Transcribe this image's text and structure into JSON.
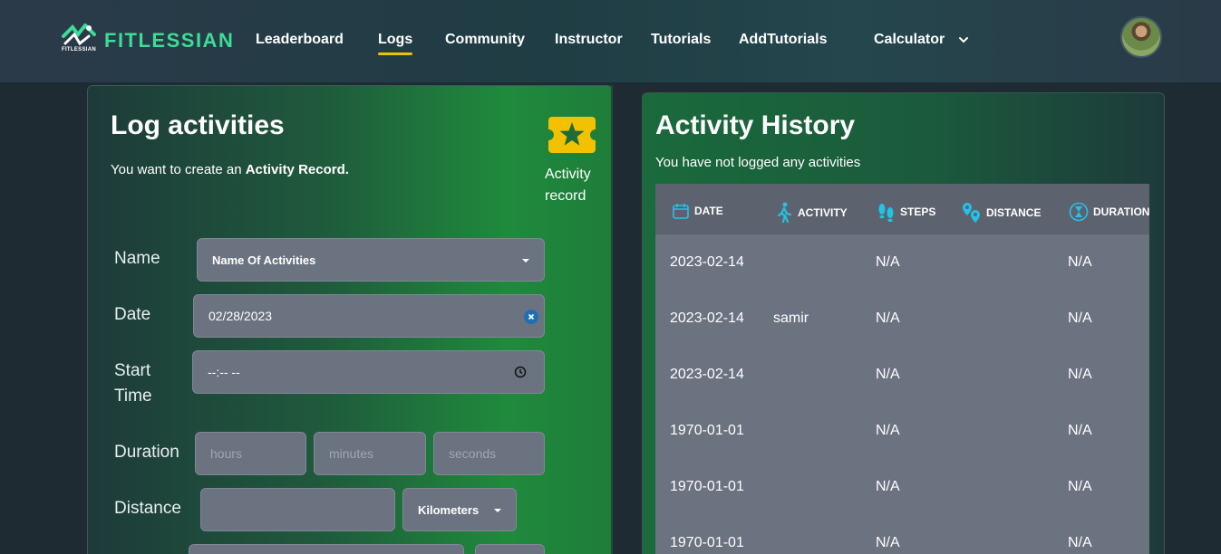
{
  "brand": {
    "name": "FITLESSIAN",
    "sub": "FITLESSIAN"
  },
  "nav": {
    "links": [
      "Leaderboard",
      "Logs",
      "Community",
      "Instructor",
      "Tutorials",
      "AddTutorials"
    ],
    "active": "Logs",
    "calculator": "Calculator"
  },
  "log": {
    "title": "Log activities",
    "subtitle_prefix": "You want to create an ",
    "subtitle_bold": "Activity Record.",
    "badge_label": "Activity record",
    "fields": {
      "name_label": "Name",
      "name_value": "Name Of Activities",
      "date_label": "Date",
      "date_value": "02/28/2023",
      "start_label_1": "Start",
      "start_label_2": "Time",
      "start_value": "--:-- --",
      "duration_label": "Duration",
      "hours_ph": "hours",
      "minutes_ph": "minutes",
      "seconds_ph": "seconds",
      "distance_label": "Distance",
      "distance_value": "",
      "unit": "Kilometers"
    }
  },
  "history": {
    "title": "Activity History",
    "subtitle": "You have not logged any activities",
    "columns": [
      "DATE",
      "ACTIVITY",
      "STEPS",
      "DISTANCE",
      "DURATION"
    ],
    "rows": [
      {
        "date": "2023-02-14",
        "activity": "",
        "steps": "N/A",
        "distance": "",
        "duration": "N/A"
      },
      {
        "date": "2023-02-14",
        "activity": "samir",
        "steps": "N/A",
        "distance": "",
        "duration": "N/A"
      },
      {
        "date": "2023-02-14",
        "activity": "",
        "steps": "N/A",
        "distance": "",
        "duration": "N/A"
      },
      {
        "date": "1970-01-01",
        "activity": "",
        "steps": "N/A",
        "distance": "",
        "duration": "N/A"
      },
      {
        "date": "1970-01-01",
        "activity": "",
        "steps": "N/A",
        "distance": "",
        "duration": "N/A"
      },
      {
        "date": "1970-01-01",
        "activity": "",
        "steps": "N/A",
        "distance": "",
        "duration": "N/A"
      }
    ]
  },
  "colors": {
    "accent": "#3ddc97",
    "active_underline": "#f2c200",
    "icon": "#22c3e6",
    "badge": "#f2c200"
  }
}
